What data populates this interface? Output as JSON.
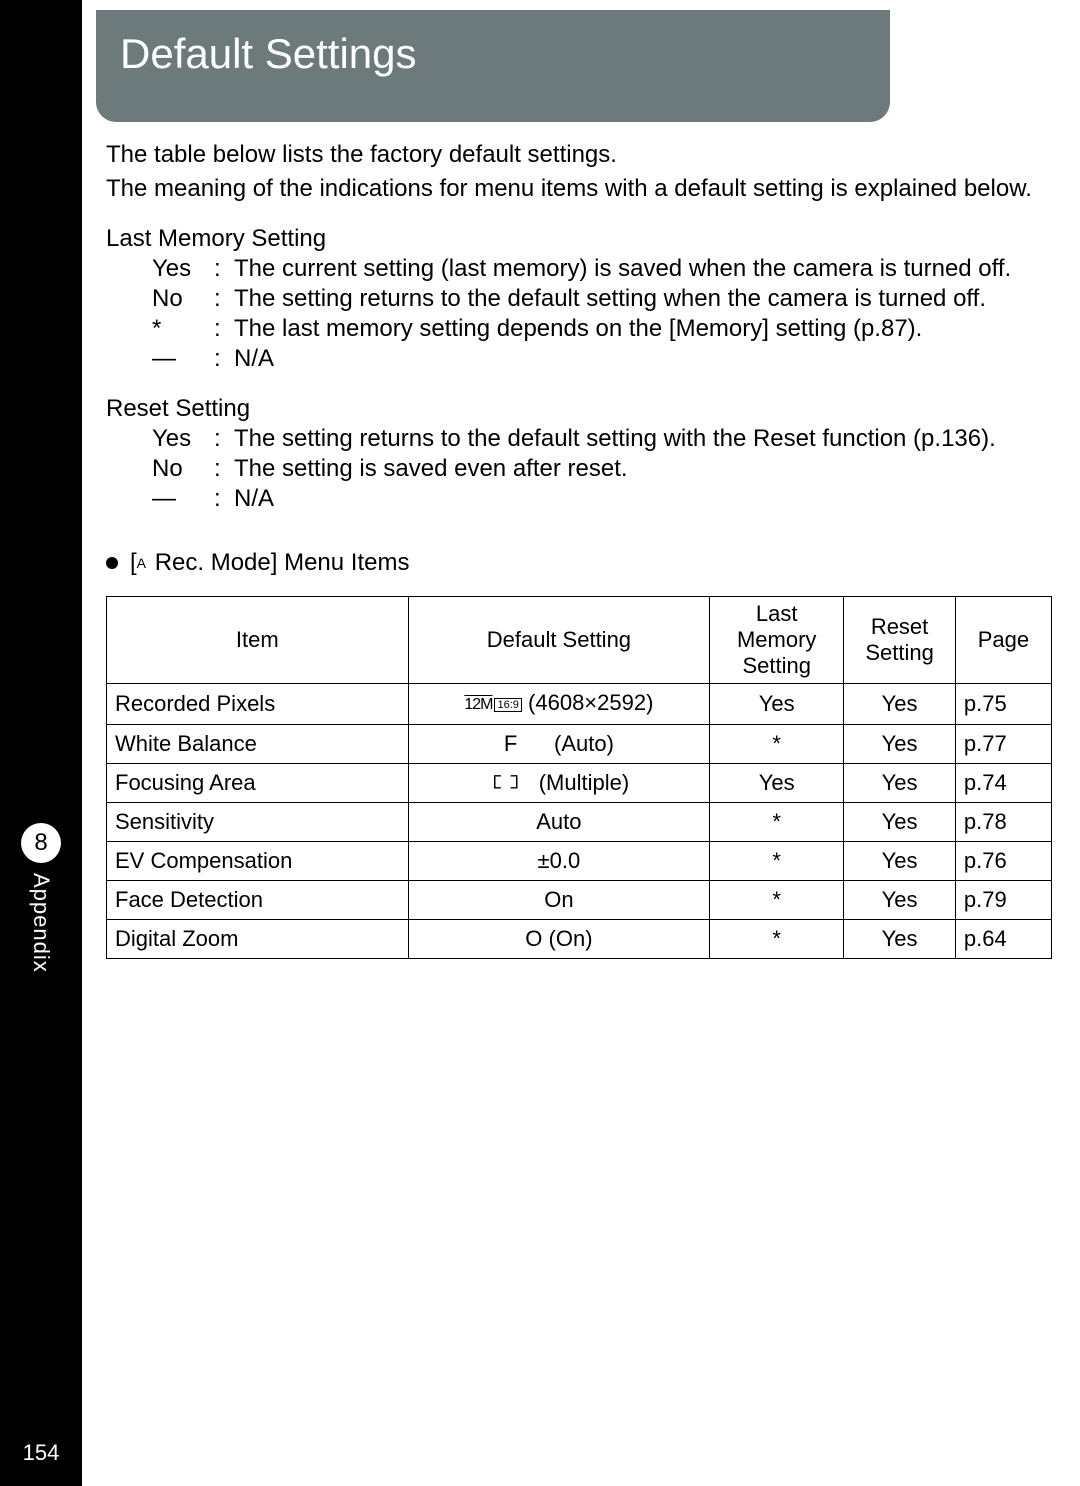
{
  "sidebar": {
    "chapter_number": "8",
    "appendix_label": "Appendix",
    "page_number": "154"
  },
  "title": "Default Settings",
  "intro": {
    "line1": "The table below lists the factory default settings.",
    "line2": "The meaning of the indications for menu items with a default setting is explained below."
  },
  "last_memory": {
    "heading": "Last Memory Setting",
    "defs": [
      {
        "key": "Yes",
        "text": "The current setting (last memory) is saved when the camera is turned off."
      },
      {
        "key": "No",
        "text": "The setting returns to the default setting when the camera is turned off."
      },
      {
        "key": "*",
        "text": "The last memory setting depends on the [Memory] setting (p.87)."
      },
      {
        "key": "—",
        "text": "N/A"
      }
    ]
  },
  "reset": {
    "heading": "Reset Setting",
    "defs": [
      {
        "key": "Yes",
        "text": "The setting returns to the default setting with the Reset function (p.136)."
      },
      {
        "key": "No",
        "text": "The setting is saved even after reset."
      },
      {
        "key": "—",
        "text": "N/A"
      }
    ]
  },
  "table": {
    "heading_prefix": "[",
    "heading_mode_letter": "A",
    "heading_suffix": "Rec. Mode] Menu Items",
    "columns": {
      "item": "Item",
      "default": "Default Setting",
      "last_memory": "Last Memory Setting",
      "reset": "Reset Setting",
      "page": "Page"
    },
    "rows": [
      {
        "item": "Recorded Pixels",
        "default_icon": "12M 16:9",
        "default_text": "(4608×2592)",
        "last": "Yes",
        "reset": "Yes",
        "page": "p.75"
      },
      {
        "item": "White Balance",
        "default_icon": "F",
        "default_text": "(Auto)",
        "last": "*",
        "reset": "Yes",
        "page": "p.77"
      },
      {
        "item": "Focusing Area",
        "default_icon": "bracket",
        "default_text": "(Multiple)",
        "last": "Yes",
        "reset": "Yes",
        "page": "p.74"
      },
      {
        "item": "Sensitivity",
        "default_icon": "",
        "default_text": "Auto",
        "last": "*",
        "reset": "Yes",
        "page": "p.78"
      },
      {
        "item": "EV Compensation",
        "default_icon": "",
        "default_text": "±0.0",
        "last": "*",
        "reset": "Yes",
        "page": "p.76"
      },
      {
        "item": "Face Detection",
        "default_icon": "",
        "default_text": "On",
        "last": "*",
        "reset": "Yes",
        "page": "p.79"
      },
      {
        "item": "Digital Zoom",
        "default_icon": "O",
        "default_text": "(On)",
        "last": "*",
        "reset": "Yes",
        "page": "p.64"
      }
    ]
  }
}
